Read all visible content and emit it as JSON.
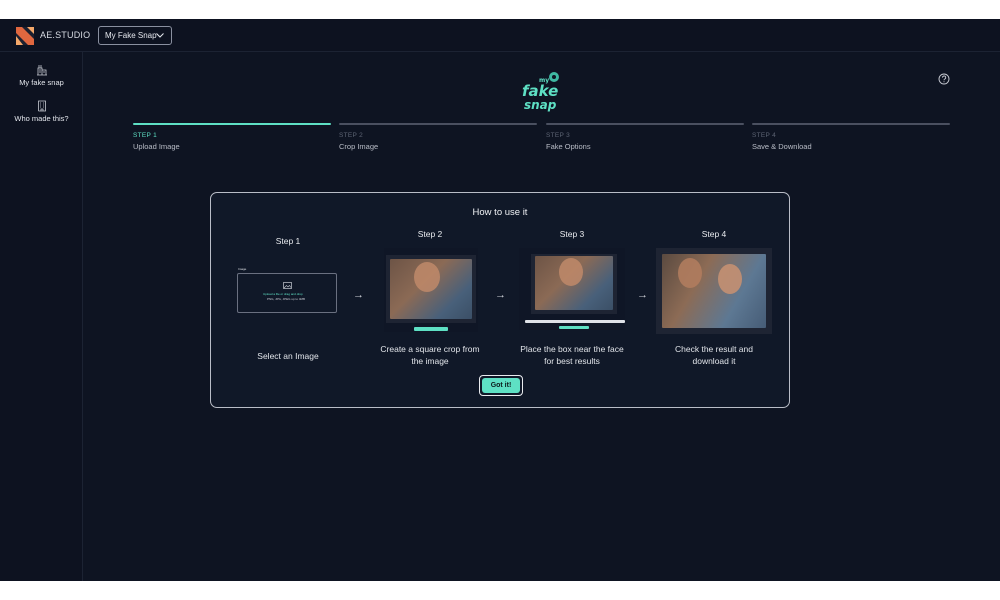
{
  "topbar": {
    "brand": "AE.STUDIO",
    "project_select": "My Fake Snap"
  },
  "sidebar": {
    "items": [
      {
        "label": "My fake snap",
        "icon": "building-icon"
      },
      {
        "label": "Who made this?",
        "icon": "office-icon"
      }
    ]
  },
  "app_logo": {
    "top": "my",
    "middle": "fake",
    "bottom": "snap"
  },
  "stepper": [
    {
      "num": "STEP 1",
      "label": "Upload Image",
      "active": true
    },
    {
      "num": "STEP 2",
      "label": "Crop Image",
      "active": false
    },
    {
      "num": "STEP 3",
      "label": "Fake Options",
      "active": false
    },
    {
      "num": "STEP 4",
      "label": "Save & Download",
      "active": false
    }
  ],
  "modal": {
    "title": "How to use it",
    "steps": [
      {
        "title": "Step 1",
        "desc_line1": "Select an Image",
        "desc_line2": ""
      },
      {
        "title": "Step 2",
        "desc_line1": "Create a square crop from",
        "desc_line2": "the image"
      },
      {
        "title": "Step 3",
        "desc_line1": "Place the box near the face",
        "desc_line2": "for best results"
      },
      {
        "title": "Step 4",
        "desc_line1": "Check the result and",
        "desc_line2": "download it"
      }
    ],
    "arrow": "→",
    "got_it": "Got it!"
  },
  "mini_upload": {
    "label": "Image",
    "line1": "Upload a file or drag and drop",
    "line2": "PNG, JPG, JPEG up to 4MB"
  },
  "colors": {
    "accent": "#5ee0c4",
    "background": "#0e1422",
    "panel": "#101828",
    "text": "#e9ebef"
  }
}
